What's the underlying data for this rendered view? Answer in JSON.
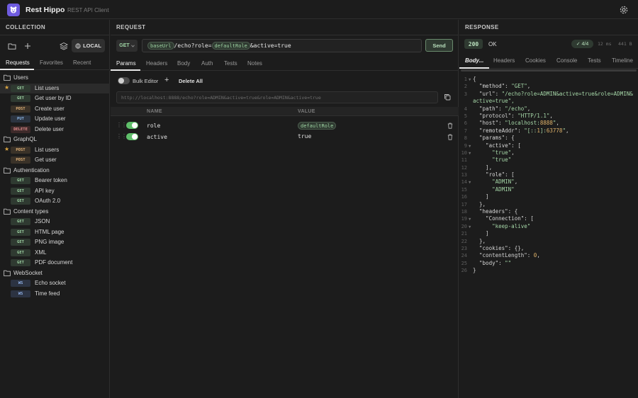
{
  "app": {
    "name": "Rest Hippo",
    "subtitle": "REST API Client"
  },
  "collection": {
    "heading": "COLLECTION",
    "env_button": "LOCAL",
    "tabs": [
      "Requests",
      "Favorites",
      "Recent"
    ],
    "tree": [
      {
        "kind": "folder",
        "label": "Users"
      },
      {
        "kind": "request",
        "method": "GET",
        "label": "List users",
        "starred": true,
        "selected": true
      },
      {
        "kind": "request",
        "method": "GET",
        "label": "Get user by ID"
      },
      {
        "kind": "request",
        "method": "POST",
        "label": "Create user"
      },
      {
        "kind": "request",
        "method": "PUT",
        "label": "Update user"
      },
      {
        "kind": "request",
        "method": "DELETE",
        "label": "Delete user"
      },
      {
        "kind": "folder",
        "label": "GraphQL"
      },
      {
        "kind": "request",
        "method": "POST",
        "label": "List users",
        "starred": true
      },
      {
        "kind": "request",
        "method": "POST",
        "label": "Get user"
      },
      {
        "kind": "folder",
        "label": "Authentication"
      },
      {
        "kind": "request",
        "method": "GET",
        "label": "Bearer token"
      },
      {
        "kind": "request",
        "method": "GET",
        "label": "API key"
      },
      {
        "kind": "request",
        "method": "GET",
        "label": "OAuth 2.0"
      },
      {
        "kind": "folder",
        "label": "Content types"
      },
      {
        "kind": "request",
        "method": "GET",
        "label": "JSON"
      },
      {
        "kind": "request",
        "method": "GET",
        "label": "HTML page"
      },
      {
        "kind": "request",
        "method": "GET",
        "label": "PNG image"
      },
      {
        "kind": "request",
        "method": "GET",
        "label": "XML"
      },
      {
        "kind": "request",
        "method": "GET",
        "label": "PDF document"
      },
      {
        "kind": "folder",
        "label": "WebSocket"
      },
      {
        "kind": "request",
        "method": "WS",
        "label": "Echo socket"
      },
      {
        "kind": "request",
        "method": "WS",
        "label": "Time feed"
      }
    ]
  },
  "request": {
    "heading": "REQUEST",
    "method": "GET",
    "url": {
      "var_base": "baseUrl",
      "path_part": "/echo?role=",
      "var_role": "defaultRole",
      "tail": "&active=true"
    },
    "send_label": "Send",
    "tabs": [
      "Params",
      "Headers",
      "Body",
      "Auth",
      "Tests",
      "Notes"
    ],
    "bulk_editor_label": "Bulk Editor",
    "add_label": "+",
    "delete_all_label": "Delete All",
    "preview_url": "http://localhost:8888/echo?role=ADMIN&active=true&role=ADMIN&active=true",
    "columns": {
      "name": "NAME",
      "value": "VALUE"
    },
    "params": [
      {
        "name": "role",
        "value": "defaultRole",
        "value_is_var": true,
        "enabled": true
      },
      {
        "name": "active",
        "value": "true",
        "value_is_var": false,
        "enabled": true
      }
    ]
  },
  "response": {
    "heading": "RESPONSE",
    "status_code": "200",
    "status_text": "OK",
    "tests_badge": "✓ 4/4",
    "time": "12 ms",
    "size": "441 B",
    "tabs": [
      "Body...",
      "Headers",
      "Cookies",
      "Console",
      "Tests",
      "Timeline"
    ],
    "body_lines": [
      "{",
      "  \"method\": \"GET\",",
      "  \"url\": \"/echo?role=ADMIN&active=true&role=ADMIN&",
      "active=true\",",
      "  \"path\": \"/echo\",",
      "  \"protocol\": \"HTTP/1.1\",",
      "  \"host\": \"localhost:8888\",",
      "  \"remoteAddr\": \"[::1]:63778\",",
      "  \"params\": {",
      "    \"active\": [",
      "      \"true\",",
      "      \"true\"",
      "    ],",
      "    \"role\": [",
      "      \"ADMIN\",",
      "      \"ADMIN\"",
      "    ]",
      "  },",
      "  \"headers\": {",
      "    \"Connection\": [",
      "      \"keep-alive\"",
      "    ]",
      "  },",
      "  \"cookies\": {},",
      "  \"contentLength\": 0,",
      "  \"body\": \"\"",
      "}"
    ],
    "line_numbers": [
      "1",
      "2",
      "3",
      "",
      "4",
      "5",
      "6",
      "7",
      "8",
      "9",
      "10",
      "11",
      "12",
      "13",
      "14",
      "15",
      "16",
      "17",
      "18",
      "19",
      "20",
      "21",
      "22",
      "23",
      "24",
      "25",
      "26"
    ]
  },
  "colors": {
    "accent": "#6f5ce0",
    "green": "#5fbf6a",
    "star": "#d9a441"
  }
}
